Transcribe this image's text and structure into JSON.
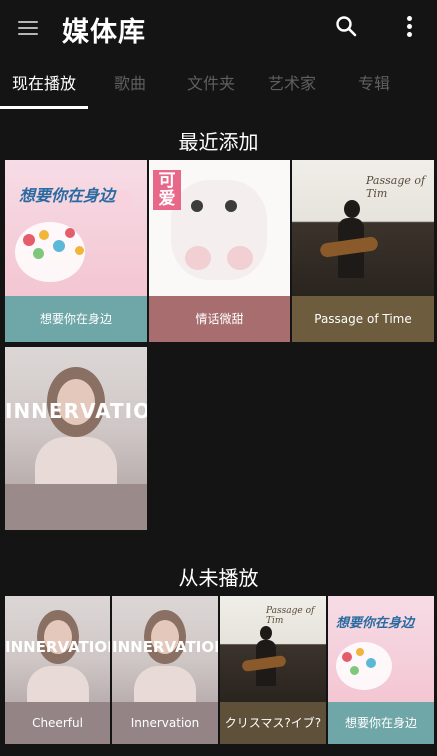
{
  "appbar": {
    "title": "媒体库",
    "icons": [
      "menu-icon",
      "search-icon",
      "more-vert-icon"
    ]
  },
  "tabs": [
    {
      "label": "现在播放",
      "active": true
    },
    {
      "label": "歌曲",
      "active": false
    },
    {
      "label": "文件夹",
      "active": false
    },
    {
      "label": "艺术家",
      "active": false
    },
    {
      "label": "专辑",
      "active": false
    }
  ],
  "recent": {
    "title": "最近添加",
    "items": [
      {
        "label": "想要你在身边",
        "caption_color": "#6fa6a8",
        "art_title": "想要你在身边"
      },
      {
        "label": "情话微甜",
        "caption_color": "#a86d6f",
        "art_title": "可爱"
      },
      {
        "label": "Passage of Time",
        "caption_color": "#6d5c3d",
        "art_title": "Passage of Tim"
      },
      {
        "label": "",
        "caption_color": "#9a8a89",
        "art_title": "INNERVATION"
      }
    ]
  },
  "unplayed": {
    "title": "从未播放",
    "items": [
      {
        "label": "Cheerful",
        "caption_color": "#958485",
        "art_title": "INNERVATION"
      },
      {
        "label": "Innervation",
        "caption_color": "#958485",
        "art_title": "INNERVATION"
      },
      {
        "label": "クリスマス?イブ?",
        "caption_color": "#5f503a",
        "art_title": "Passage of Tim"
      },
      {
        "label": "想要你在身边",
        "caption_color": "#6fa6a8",
        "art_title": "想要你在身边"
      }
    ]
  }
}
